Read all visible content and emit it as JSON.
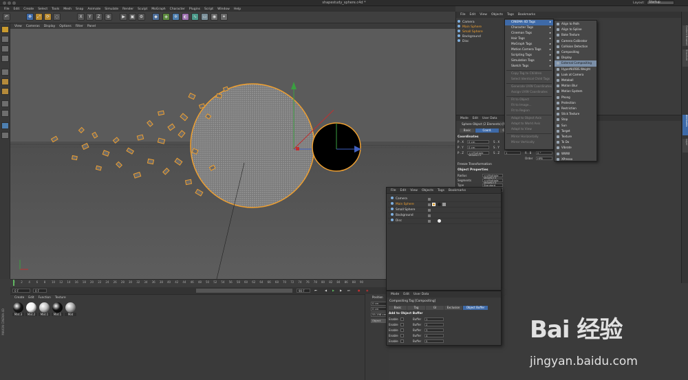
{
  "window": {
    "title": "shapestudy_sphere.c4d *"
  },
  "menubar": [
    "File",
    "Edit",
    "Create",
    "Select",
    "Tools",
    "Mesh",
    "Snap",
    "Animate",
    "Simulate",
    "Render",
    "Sculpt",
    "MoGraph",
    "Character",
    "Plugins",
    "Script",
    "Window",
    "Help"
  ],
  "toolbar": {
    "axes": [
      "X",
      "Y",
      "Z"
    ]
  },
  "layout": {
    "label": "Layout:",
    "value": "Startup"
  },
  "viewport": {
    "menu": [
      "View",
      "Cameras",
      "Display",
      "Options",
      "Filter",
      "Panel"
    ],
    "label": "Perspective"
  },
  "timeline": {
    "ticks": [
      "0",
      "2",
      "4",
      "6",
      "8",
      "10",
      "12",
      "14",
      "16",
      "18",
      "20",
      "22",
      "24",
      "26",
      "28",
      "30",
      "32",
      "34",
      "36",
      "38",
      "40",
      "42",
      "44",
      "46",
      "48",
      "50",
      "52",
      "54",
      "56",
      "58",
      "60",
      "62",
      "64",
      "66",
      "68",
      "70",
      "72",
      "74",
      "76",
      "78",
      "80",
      "82",
      "84",
      "86",
      "88",
      "90"
    ],
    "current_frame": "0 F",
    "start_frame": "0 F",
    "end_frame": "90 F",
    "end_frame2": "90 F"
  },
  "materials": {
    "menu": [
      "Create",
      "Edit",
      "Function",
      "Texture"
    ],
    "items": [
      {
        "name": "Mat.3",
        "color": "#1a1a1a"
      },
      {
        "name": "Mat.2",
        "color": "#f2f2f2"
      },
      {
        "name": "Mat.1",
        "color": "#bdbdbd"
      },
      {
        "name": "Mat.1",
        "color": "#111111"
      },
      {
        "name": "Mat",
        "color": "#a9a9a9"
      }
    ],
    "brand": "MAXON CINEMA 4D"
  },
  "coords_bottom": {
    "header": "Position",
    "x": "0 cm",
    "y": "0 cm",
    "z": "55.198 cm",
    "mode": "Object"
  },
  "object_manager": {
    "menu": [
      "File",
      "Edit",
      "View",
      "Objects",
      "Tags",
      "Bookmarks"
    ],
    "objects": [
      {
        "name": "Camera",
        "color": "#d8d8d8"
      },
      {
        "name": "Main Sphere",
        "color": "#f0a030"
      },
      {
        "name": "Small Sphere",
        "color": "#f0a030"
      },
      {
        "name": "Background",
        "color": "#d8d8d8"
      },
      {
        "name": "Disc",
        "color": "#d8d8d8"
      }
    ]
  },
  "tags_menu": {
    "items": [
      {
        "label": "CINEMA 4D Tags",
        "state": "highlight",
        "submenu": true
      },
      {
        "label": "Character Tags",
        "state": "normal",
        "submenu": true
      },
      {
        "label": "Cineman Tags",
        "state": "normal",
        "submenu": true
      },
      {
        "label": "Hair Tags",
        "state": "normal",
        "submenu": true
      },
      {
        "label": "MoGraph Tags",
        "state": "normal",
        "submenu": true
      },
      {
        "label": "Motion Camera Tags",
        "state": "normal",
        "submenu": true
      },
      {
        "label": "Scripting Tags",
        "state": "normal",
        "submenu": true
      },
      {
        "label": "Simulation Tags",
        "state": "normal",
        "submenu": true
      },
      {
        "label": "Sketch Tags",
        "state": "normal",
        "submenu": true
      },
      {
        "label": "Copy Tag to Children",
        "state": "disabled",
        "submenu": false
      },
      {
        "label": "Select Identical Child Tags",
        "state": "disabled",
        "submenu": false
      },
      {
        "label": "Generate UVW Coordinates",
        "state": "disabled",
        "submenu": false
      },
      {
        "label": "Assign UVW Coordinates",
        "state": "disabled",
        "submenu": false
      },
      {
        "label": "Fit to Object",
        "state": "disabled",
        "submenu": false
      },
      {
        "label": "Fit to Image...",
        "state": "disabled",
        "submenu": false
      },
      {
        "label": "Fit to Region",
        "state": "disabled",
        "submenu": false
      },
      {
        "label": "Adapt to Object Axis",
        "state": "disabled",
        "submenu": false
      },
      {
        "label": "Adapt to World Axis",
        "state": "disabled",
        "submenu": false
      },
      {
        "label": "Adapt to View",
        "state": "disabled",
        "submenu": false
      },
      {
        "label": "Mirror Horizontally",
        "state": "disabled",
        "submenu": false
      },
      {
        "label": "Mirror Vertically",
        "state": "disabled",
        "submenu": false
      }
    ]
  },
  "c4d_tags_submenu": {
    "items": [
      "Align to Path",
      "Align to Spline",
      "Bake Texture",
      "Camera Calibrator",
      "Collision Detection",
      "Compositing",
      "Display",
      "External Compositing",
      "HyperNURBS Weight",
      "Look at Camera",
      "Metaball",
      "Motion Blur",
      "Motion System",
      "Phong",
      "Protection",
      "Restriction",
      "Stick Texture",
      "Stop",
      "Sun",
      "Target",
      "Texture",
      "To Do",
      "Vibrate",
      "WWW",
      "XPresso"
    ],
    "highlighted": "External Compositing"
  },
  "attribute_manager": {
    "menu": [
      "Mode",
      "Edit",
      "User Data"
    ],
    "object_title": "Sphere Object (2 Elements) [Main Sphere, Small Sphere]",
    "tabs": [
      "Basic",
      "Coord.",
      "Object",
      "Phong"
    ],
    "coordinates_title": "Coordinates",
    "coords": [
      {
        "label": "P . X",
        "value": "0 cm",
        "slabel": "S . X",
        "svalue": "1",
        "rlabel": "R . H",
        "rvalue": "0 °"
      },
      {
        "label": "P . Y",
        "value": "0 cm",
        "slabel": "S . Y",
        "svalue": "1",
        "rlabel": "R . P",
        "rvalue": "0 °"
      },
      {
        "label": "P . Z",
        "value": "<<Multiple Values>>",
        "slabel": "S . Z",
        "svalue": "1",
        "rlabel": "R . B",
        "rvalue": "0 °"
      }
    ],
    "order_label": "Order",
    "order_value": "HPB",
    "freeze": "Freeze Transformation",
    "object_props_title": "Object Properties",
    "props": [
      {
        "label": "Radius",
        "value": "<<Multiple Values>>"
      },
      {
        "label": "Segments",
        "value": "<<Multiple Values>>"
      },
      {
        "label": "Type",
        "value": "Standard"
      },
      {
        "label": "Render Perfect",
        "value": ""
      }
    ]
  },
  "right_strip": [
    "Content Browser",
    "Structure",
    "Attributes",
    "Layer"
  ],
  "float_object_manager": {
    "menu": [
      "File",
      "Edit",
      "View",
      "Objects",
      "Tags",
      "Bookmarks"
    ],
    "objects": [
      {
        "name": "Camera",
        "color": "#d8d8d8"
      },
      {
        "name": "Main Sphere",
        "color": "#f0a030"
      },
      {
        "name": "Small Sphere",
        "color": "#d8d8d8"
      },
      {
        "name": "Background",
        "color": "#d8d8d8"
      },
      {
        "name": "Disc",
        "color": "#d8d8d8"
      }
    ]
  },
  "float_attribute_manager": {
    "menu": [
      "Mode",
      "Edit",
      "User Data"
    ],
    "title": "Compositing Tag [Compositing]",
    "tabs": [
      "Basic",
      "Tag",
      "GI",
      "Exclusion",
      "Object Buffer"
    ],
    "active_tab": "Object Buffer",
    "section": "Add to Object Buffer",
    "buffers": [
      {
        "enable": "Enable",
        "buffer": "Buffer",
        "value": "1"
      },
      {
        "enable": "Enable",
        "buffer": "Buffer",
        "value": "2"
      },
      {
        "enable": "Enable",
        "buffer": "Buffer",
        "value": "3"
      },
      {
        "enable": "Enable",
        "buffer": "Buffer",
        "value": "4"
      },
      {
        "enable": "Enable",
        "buffer": "Buffer",
        "value": "5"
      }
    ]
  },
  "watermark": {
    "brand": "Bai 经验",
    "url": "jingyan.baidu.com"
  }
}
